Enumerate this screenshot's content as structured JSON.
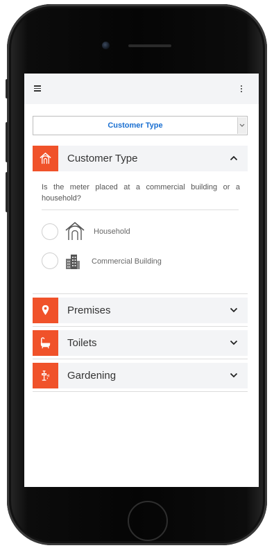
{
  "select": {
    "value": "Customer Type"
  },
  "accordion": [
    {
      "title": "Customer Type",
      "icon": "house-icon",
      "expanded": true
    },
    {
      "title": "Premises",
      "icon": "location-pin-icon",
      "expanded": false
    },
    {
      "title": "Toilets",
      "icon": "bathtub-icon",
      "expanded": false
    },
    {
      "title": "Gardening",
      "icon": "garden-tap-icon",
      "expanded": false
    }
  ],
  "question": "Is the meter placed at a commercial building or a household?",
  "options": [
    {
      "label": "Household",
      "icon": "house-outline-icon"
    },
    {
      "label": "Commercial Building",
      "icon": "office-building-icon"
    }
  ],
  "colors": {
    "accent": "#f0522a",
    "link": "#1a6fd1",
    "header_bg": "#f3f4f6"
  }
}
